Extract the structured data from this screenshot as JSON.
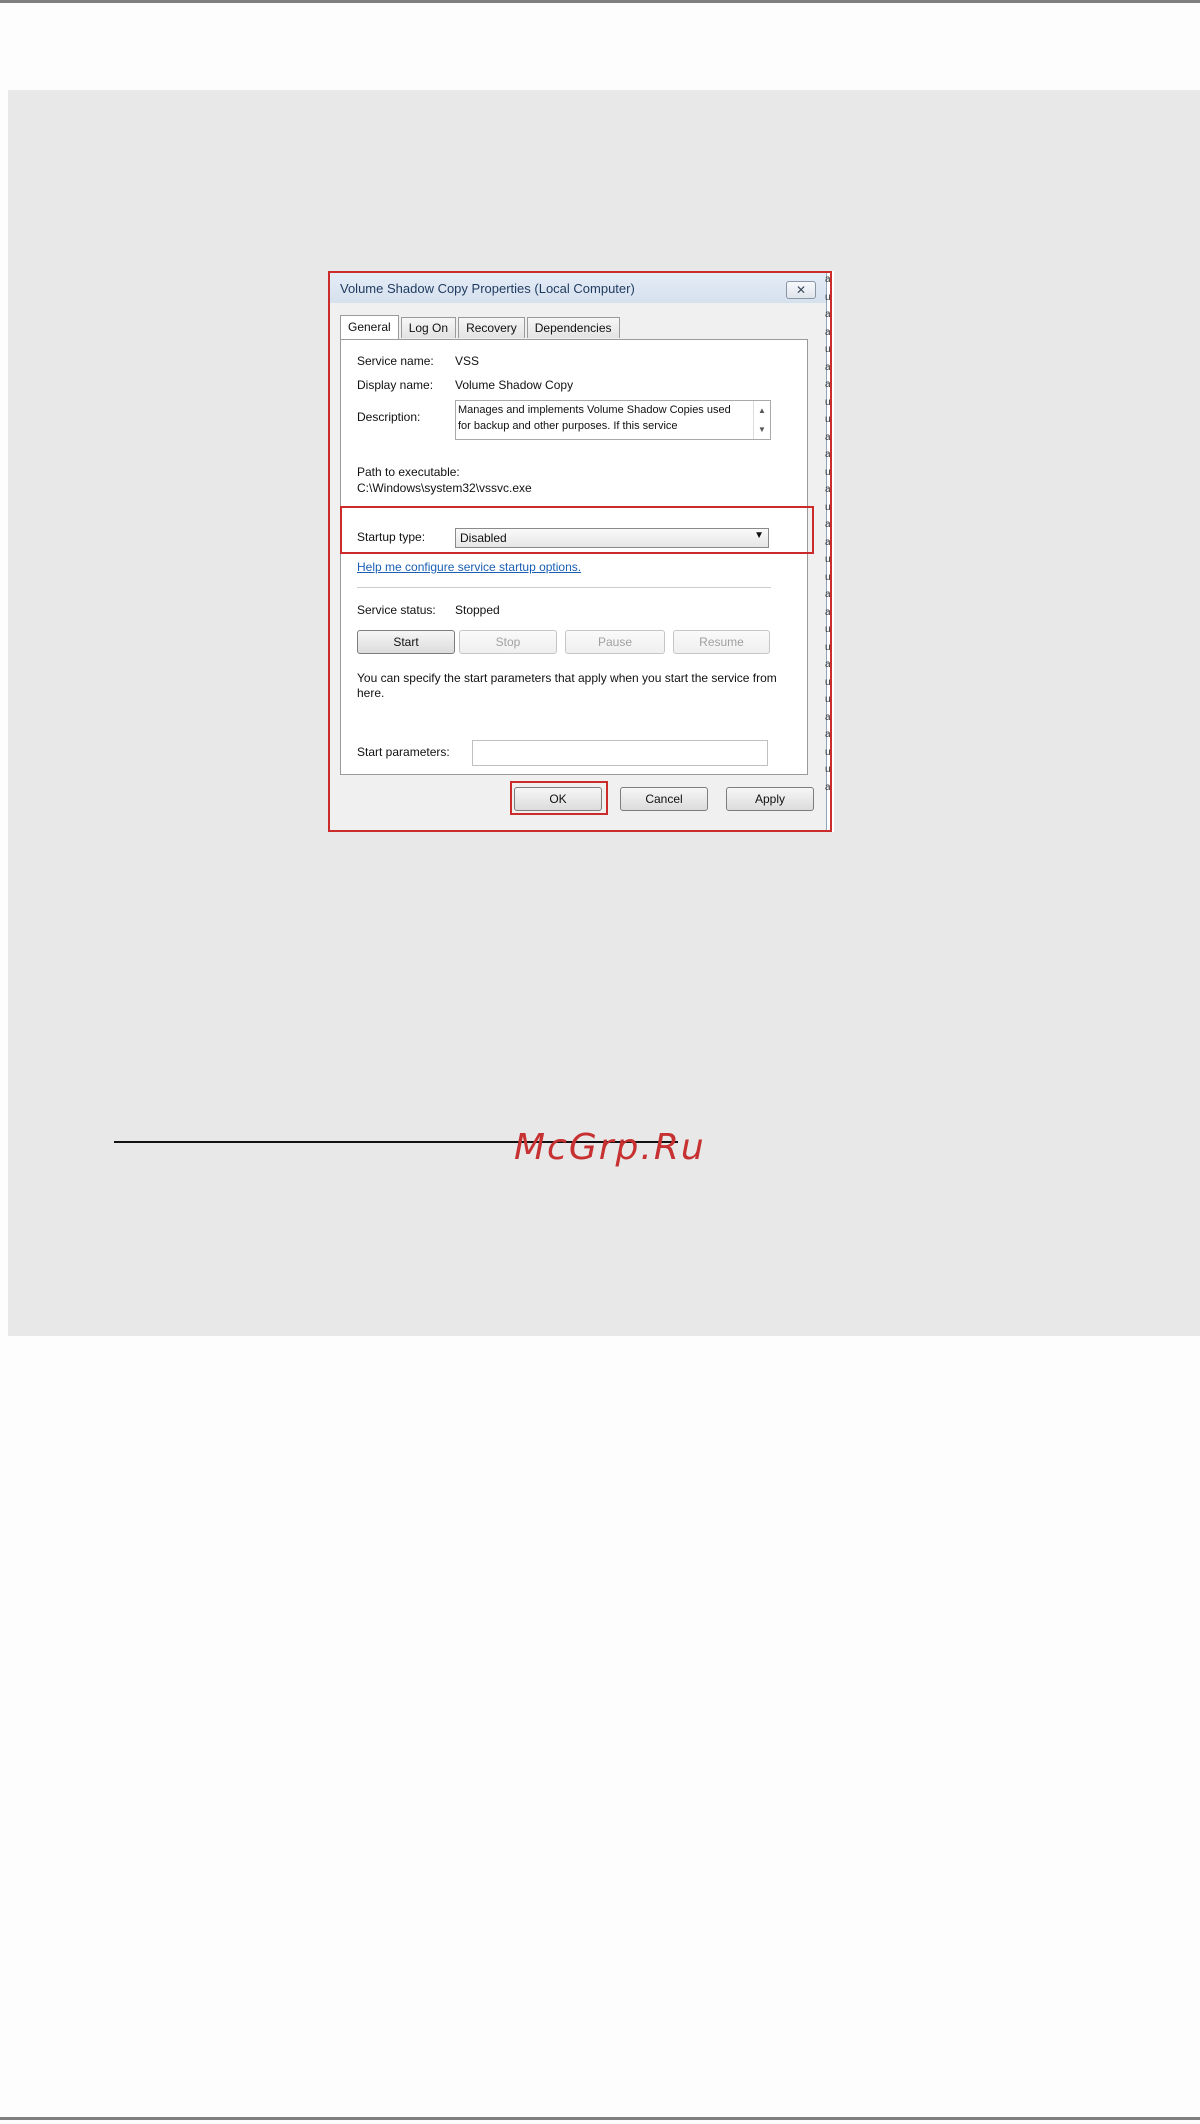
{
  "dialog": {
    "title": "Volume Shadow Copy Properties (Local Computer)",
    "close_glyph": "✕",
    "tabs": [
      {
        "label": "General",
        "active": true
      },
      {
        "label": "Log On",
        "active": false
      },
      {
        "label": "Recovery",
        "active": false
      },
      {
        "label": "Dependencies",
        "active": false
      }
    ],
    "service_name_label": "Service name:",
    "service_name": "VSS",
    "display_name_label": "Display name:",
    "display_name": "Volume Shadow Copy",
    "description_label": "Description:",
    "description": "Manages and implements Volume Shadow Copies used for backup and other purposes. If this service",
    "path_label": "Path to executable:",
    "path": "C:\\Windows\\system32\\vssvc.exe",
    "startup_type_label": "Startup type:",
    "startup_type": "Disabled",
    "help_link": "Help me configure service startup options.",
    "service_status_label": "Service status:",
    "service_status": "Stopped",
    "buttons": {
      "start": "Start",
      "stop": "Stop",
      "pause": "Pause",
      "resume": "Resume",
      "ok": "OK",
      "cancel": "Cancel",
      "apply": "Apply"
    },
    "params_hint": "You can specify the start parameters that apply when you start the service from here.",
    "start_params_label": "Start parameters:",
    "start_params_value": ""
  },
  "watermark": "McGrp.Ru",
  "colors": {
    "highlight": "#cc2b2b",
    "link": "#1a5fb4",
    "panel": "#e8e8e8",
    "watermark": "#c73131"
  }
}
